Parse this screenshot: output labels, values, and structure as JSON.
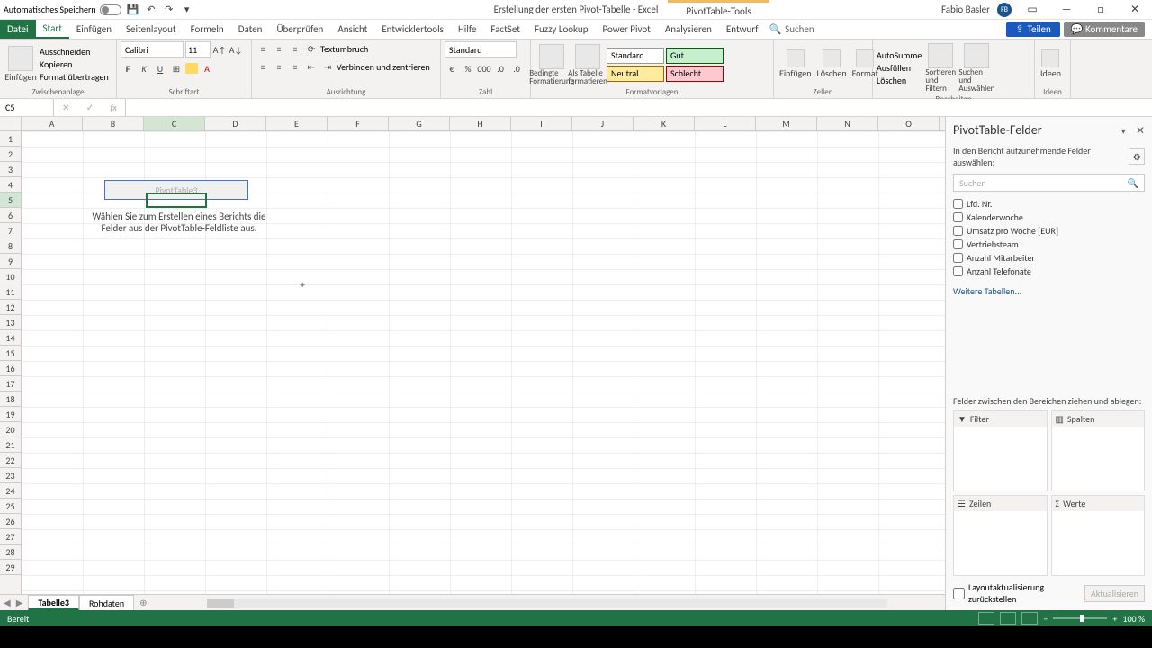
{
  "titlebar": {
    "autosave": "Automatisches Speichern",
    "doc_title": "Erstellung der ersten Pivot-Tabelle  -  Excel",
    "pivot_tools": "PivotTable-Tools",
    "user": "Fabio Basler",
    "user_initials": "FB"
  },
  "tabs": {
    "file": "Datei",
    "start": "Start",
    "einfuegen": "Einfügen",
    "seitenlayout": "Seitenlayout",
    "formeln": "Formeln",
    "daten": "Daten",
    "ueberpruefen": "Überprüfen",
    "ansicht": "Ansicht",
    "entwickler": "Entwicklertools",
    "hilfe": "Hilfe",
    "factset": "FactSet",
    "fuzzy": "Fuzzy Lookup",
    "powerpivot": "Power Pivot",
    "analysieren": "Analysieren",
    "entwurf": "Entwurf",
    "search_ph": "Suchen",
    "teilen": "Teilen",
    "kommentare": "Kommentare"
  },
  "ribbon": {
    "clipboard": {
      "paste": "Einfügen",
      "cut": "Ausschneiden",
      "copy": "Kopieren",
      "format_painter": "Format übertragen",
      "label": "Zwischenablage"
    },
    "font": {
      "name": "Calibri",
      "size": "11",
      "label": "Schriftart"
    },
    "alignment": {
      "wrap": "Textumbruch",
      "merge": "Verbinden und zentrieren",
      "label": "Ausrichtung"
    },
    "number": {
      "format": "Standard",
      "label": "Zahl"
    },
    "styles": {
      "cond": "Bedingte Formatierung",
      "table": "Als Tabelle formatieren",
      "standard": "Standard",
      "neutral": "Neutral",
      "gut": "Gut",
      "schlecht": "Schlecht",
      "label": "Formatvorlagen"
    },
    "cells": {
      "insert": "Einfügen",
      "delete": "Löschen",
      "format": "Format",
      "label": "Zellen"
    },
    "editing": {
      "autosum": "AutoSumme",
      "fill": "Ausfüllen",
      "clear": "Löschen",
      "sort": "Sortieren und Filtern",
      "find": "Suchen und Auswählen",
      "label": "Bearbeiten"
    },
    "ideas": {
      "btn": "Ideen",
      "label": "Ideen"
    }
  },
  "formula": {
    "cell_ref": "C5"
  },
  "columns": [
    "A",
    "B",
    "C",
    "D",
    "E",
    "F",
    "G",
    "H",
    "I",
    "J",
    "K",
    "L",
    "M",
    "N",
    "O",
    "C"
  ],
  "pivot_placeholder": "PivotTable3",
  "pivot_message": "Wählen Sie zum Erstellen eines Berichts die Felder aus der PivotTable-Feldliste aus.",
  "field_pane": {
    "title": "PivotTable-Felder",
    "subtitle": "In den Bericht aufzunehmende Felder auswählen:",
    "search_ph": "Suchen",
    "fields": [
      "Lfd. Nr.",
      "Kalenderwoche",
      "Umsatz pro Woche [EUR]",
      "Vertriebsteam",
      "Anzahl Mitarbeiter",
      "Anzahl Telefonate"
    ],
    "more": "Weitere Tabellen...",
    "drag_label": "Felder zwischen den Bereichen ziehen und ablegen:",
    "filter": "Filter",
    "columns": "Spalten",
    "rows": "Zeilen",
    "values": "Werte",
    "defer": "Layoutaktualisierung zurückstellen",
    "update": "Aktualisieren"
  },
  "sheets": {
    "active": "Tabelle3",
    "other": "Rohdaten"
  },
  "status": {
    "ready": "Bereit",
    "zoom": "100 %"
  }
}
